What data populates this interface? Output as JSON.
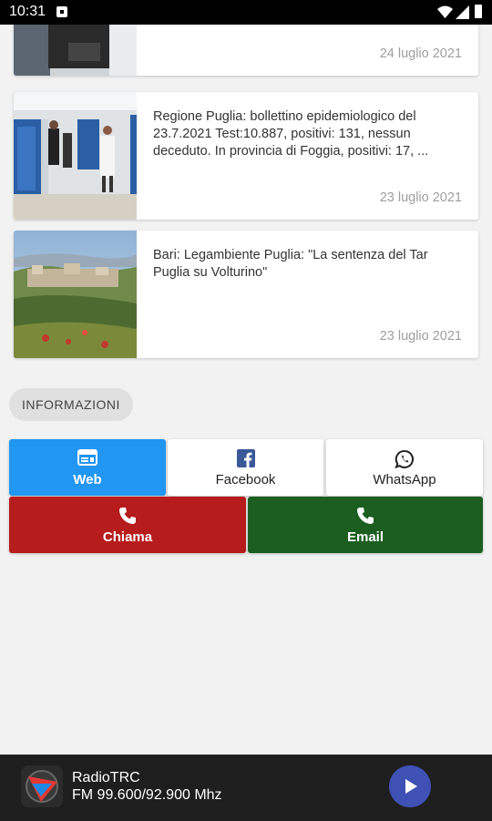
{
  "status_bar": {
    "time": "10:31"
  },
  "news": [
    {
      "title": "",
      "date": "24 luglio 2021"
    },
    {
      "title": "Regione Puglia: bollettino epidemiologico del 23.7.2021 Test:10.887, positivi: 131, nessun deceduto. In provincia di Foggia, positivi: 17, ...",
      "date": "23 luglio 2021"
    },
    {
      "title": "Bari: Legambiente Puglia: \"La sentenza del Tar Puglia su Volturino\"",
      "date": "23 luglio 2021"
    }
  ],
  "info_chip": "INFORMAZIONI",
  "contacts": {
    "web": "Web",
    "facebook": "Facebook",
    "whatsapp": "WhatsApp",
    "call": "Chiama",
    "email": "Email"
  },
  "player": {
    "station": "RadioTRC",
    "frequency": "FM 99.600/92.900 Mhz"
  },
  "colors": {
    "web": "#2196f3",
    "call": "#b71c1c",
    "email": "#1b5e20",
    "play": "#3f51b5"
  }
}
